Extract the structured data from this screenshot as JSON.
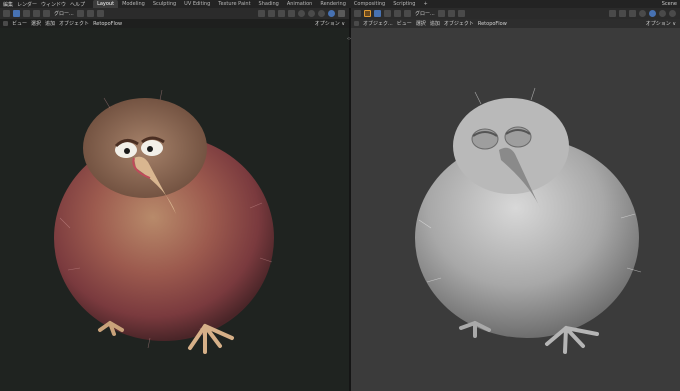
{
  "menu": [
    "編集",
    "レンダー",
    "ウィンドウ",
    "ヘルプ"
  ],
  "tabs": [
    {
      "label": "Layout",
      "active": true
    },
    {
      "label": "Modeling",
      "active": false
    },
    {
      "label": "Sculpting",
      "active": false
    },
    {
      "label": "UV Editing",
      "active": false
    },
    {
      "label": "Texture Paint",
      "active": false
    },
    {
      "label": "Shading",
      "active": false
    },
    {
      "label": "Animation",
      "active": false
    },
    {
      "label": "Rendering",
      "active": false
    },
    {
      "label": "Compositing",
      "active": false
    },
    {
      "label": "Scripting",
      "active": false
    }
  ],
  "scene_label": "Scene",
  "left_viewport": {
    "transform_orientation": "グロー...",
    "options_label": "オプション ∨",
    "menu": [
      "ビュー",
      "選択",
      "追加",
      "オブジェクト",
      "RetopoFlow"
    ],
    "shading": "rendered",
    "background_color": "#1f2320"
  },
  "right_viewport": {
    "mode_label": "オブジェク...",
    "transform_orientation": "グロー...",
    "options_label": "オプション ∨",
    "menu": [
      "ビュー",
      "選択",
      "追加",
      "オブジェクト",
      "RetopoFlow"
    ],
    "shading": "solid",
    "background_color": "#3b3b3b"
  },
  "icons": {
    "add_workspace": "+",
    "expand": "‹›"
  }
}
